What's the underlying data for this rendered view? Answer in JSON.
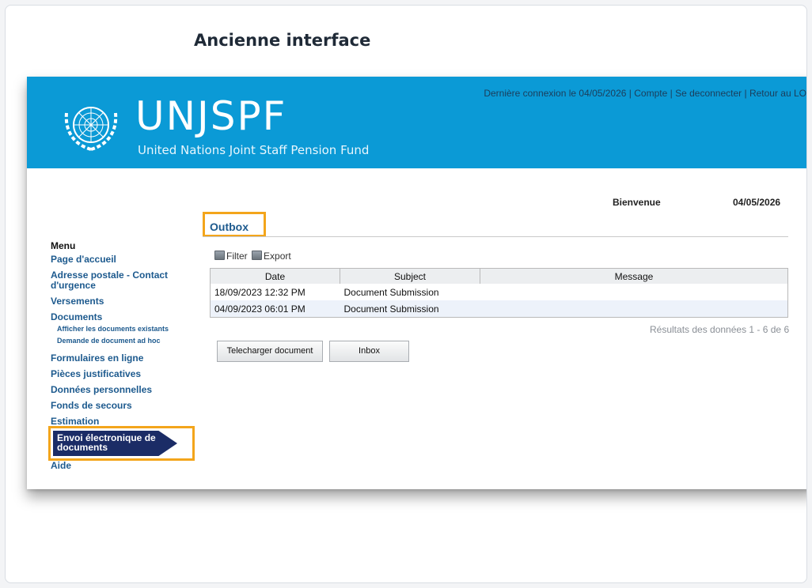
{
  "page": {
    "heading": "Ancienne interface"
  },
  "banner": {
    "brand": "UNJSPF",
    "subtitle": "United Nations Joint Staff Pension Fund",
    "last_login": "Dernière connexion le 04/05/2026",
    "account": "Compte",
    "logout": "Se deconnecter",
    "back": "Retour au LOB",
    "separator": " | ",
    "color": "#0b9ad6"
  },
  "header": {
    "welcome": "Bienvenue",
    "date": "04/05/2026"
  },
  "section": {
    "title": "Outbox"
  },
  "menu": {
    "heading": "Menu",
    "home": "Page d'accueil",
    "address": "Adresse postale - Contact d'urgence",
    "payments": "Versements",
    "documents": "Documents",
    "doc_view": "Afficher les documents existants",
    "doc_request": "Demande de document ad hoc",
    "forms": "Formulaires en ligne",
    "attachments": "Pièces justificatives",
    "personal": "Données personnelles",
    "emergency": "Fonds de secours",
    "estimation": "Estimation",
    "active": "Envoi électronique de documents",
    "help": "Aide",
    "active_color": "#1b2c66",
    "highlight_color": "#f3a51b"
  },
  "toolbar": {
    "filter": "Filter",
    "export": "Export"
  },
  "table": {
    "headers": [
      "Date",
      "Subject",
      "Message"
    ],
    "rows": [
      {
        "date": "18/09/2023 12:32 PM",
        "subject": "Document Submission",
        "message": ""
      },
      {
        "date": "04/09/2023 06:01 PM",
        "subject": "Document Submission",
        "message": ""
      }
    ]
  },
  "results": "Résultats des données 1 - 6 de 6",
  "buttons": {
    "upload": "Telecharger document",
    "inbox": "Inbox"
  }
}
